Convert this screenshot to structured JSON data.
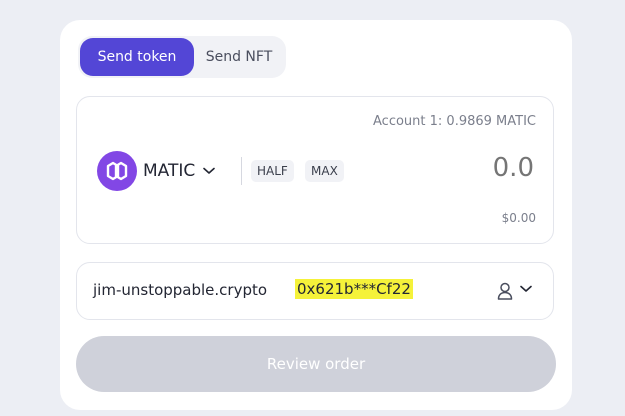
{
  "tabs": [
    {
      "label": "Send token",
      "active": true
    },
    {
      "label": "Send NFT",
      "active": false
    }
  ],
  "swap": {
    "account_balance": "Account 1: 0.9869 MATIC",
    "token": {
      "symbol": "MATIC",
      "icon": "polygon-logo-icon",
      "brand_color": "#8247e5"
    },
    "half_label": "HALF",
    "max_label": "MAX",
    "amount_placeholder": "0.0",
    "usd_value": "$0.00"
  },
  "recipient": {
    "name": "jim-unstoppable.crypto",
    "address": "0x621b***Cf22",
    "highlight_color": "#f5f23a"
  },
  "review_button": {
    "label": "Review order",
    "disabled": true
  },
  "colors": {
    "accent": "#5346d6",
    "disabled": "#cfd1da"
  }
}
